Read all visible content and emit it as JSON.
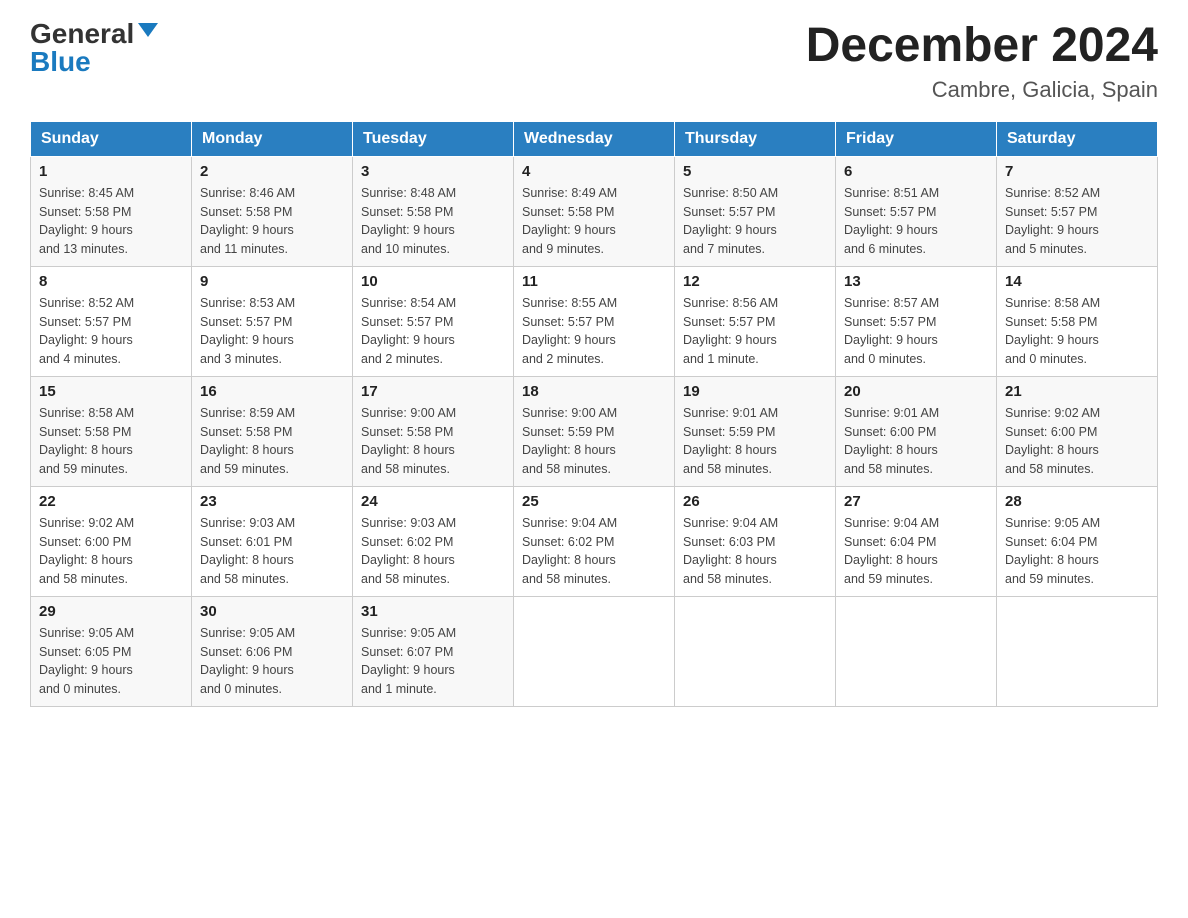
{
  "logo": {
    "general": "General",
    "blue": "Blue"
  },
  "header": {
    "month_year": "December 2024",
    "location": "Cambre, Galicia, Spain"
  },
  "days_of_week": [
    "Sunday",
    "Monday",
    "Tuesday",
    "Wednesday",
    "Thursday",
    "Friday",
    "Saturday"
  ],
  "weeks": [
    [
      {
        "day": "1",
        "sunrise": "8:45 AM",
        "sunset": "5:58 PM",
        "daylight": "9 hours and 13 minutes."
      },
      {
        "day": "2",
        "sunrise": "8:46 AM",
        "sunset": "5:58 PM",
        "daylight": "9 hours and 11 minutes."
      },
      {
        "day": "3",
        "sunrise": "8:48 AM",
        "sunset": "5:58 PM",
        "daylight": "9 hours and 10 minutes."
      },
      {
        "day": "4",
        "sunrise": "8:49 AM",
        "sunset": "5:58 PM",
        "daylight": "9 hours and 9 minutes."
      },
      {
        "day": "5",
        "sunrise": "8:50 AM",
        "sunset": "5:57 PM",
        "daylight": "9 hours and 7 minutes."
      },
      {
        "day": "6",
        "sunrise": "8:51 AM",
        "sunset": "5:57 PM",
        "daylight": "9 hours and 6 minutes."
      },
      {
        "day": "7",
        "sunrise": "8:52 AM",
        "sunset": "5:57 PM",
        "daylight": "9 hours and 5 minutes."
      }
    ],
    [
      {
        "day": "8",
        "sunrise": "8:52 AM",
        "sunset": "5:57 PM",
        "daylight": "9 hours and 4 minutes."
      },
      {
        "day": "9",
        "sunrise": "8:53 AM",
        "sunset": "5:57 PM",
        "daylight": "9 hours and 3 minutes."
      },
      {
        "day": "10",
        "sunrise": "8:54 AM",
        "sunset": "5:57 PM",
        "daylight": "9 hours and 2 minutes."
      },
      {
        "day": "11",
        "sunrise": "8:55 AM",
        "sunset": "5:57 PM",
        "daylight": "9 hours and 2 minutes."
      },
      {
        "day": "12",
        "sunrise": "8:56 AM",
        "sunset": "5:57 PM",
        "daylight": "9 hours and 1 minute."
      },
      {
        "day": "13",
        "sunrise": "8:57 AM",
        "sunset": "5:57 PM",
        "daylight": "9 hours and 0 minutes."
      },
      {
        "day": "14",
        "sunrise": "8:58 AM",
        "sunset": "5:58 PM",
        "daylight": "9 hours and 0 minutes."
      }
    ],
    [
      {
        "day": "15",
        "sunrise": "8:58 AM",
        "sunset": "5:58 PM",
        "daylight": "8 hours and 59 minutes."
      },
      {
        "day": "16",
        "sunrise": "8:59 AM",
        "sunset": "5:58 PM",
        "daylight": "8 hours and 59 minutes."
      },
      {
        "day": "17",
        "sunrise": "9:00 AM",
        "sunset": "5:58 PM",
        "daylight": "8 hours and 58 minutes."
      },
      {
        "day": "18",
        "sunrise": "9:00 AM",
        "sunset": "5:59 PM",
        "daylight": "8 hours and 58 minutes."
      },
      {
        "day": "19",
        "sunrise": "9:01 AM",
        "sunset": "5:59 PM",
        "daylight": "8 hours and 58 minutes."
      },
      {
        "day": "20",
        "sunrise": "9:01 AM",
        "sunset": "6:00 PM",
        "daylight": "8 hours and 58 minutes."
      },
      {
        "day": "21",
        "sunrise": "9:02 AM",
        "sunset": "6:00 PM",
        "daylight": "8 hours and 58 minutes."
      }
    ],
    [
      {
        "day": "22",
        "sunrise": "9:02 AM",
        "sunset": "6:00 PM",
        "daylight": "8 hours and 58 minutes."
      },
      {
        "day": "23",
        "sunrise": "9:03 AM",
        "sunset": "6:01 PM",
        "daylight": "8 hours and 58 minutes."
      },
      {
        "day": "24",
        "sunrise": "9:03 AM",
        "sunset": "6:02 PM",
        "daylight": "8 hours and 58 minutes."
      },
      {
        "day": "25",
        "sunrise": "9:04 AM",
        "sunset": "6:02 PM",
        "daylight": "8 hours and 58 minutes."
      },
      {
        "day": "26",
        "sunrise": "9:04 AM",
        "sunset": "6:03 PM",
        "daylight": "8 hours and 58 minutes."
      },
      {
        "day": "27",
        "sunrise": "9:04 AM",
        "sunset": "6:04 PM",
        "daylight": "8 hours and 59 minutes."
      },
      {
        "day": "28",
        "sunrise": "9:05 AM",
        "sunset": "6:04 PM",
        "daylight": "8 hours and 59 minutes."
      }
    ],
    [
      {
        "day": "29",
        "sunrise": "9:05 AM",
        "sunset": "6:05 PM",
        "daylight": "9 hours and 0 minutes."
      },
      {
        "day": "30",
        "sunrise": "9:05 AM",
        "sunset": "6:06 PM",
        "daylight": "9 hours and 0 minutes."
      },
      {
        "day": "31",
        "sunrise": "9:05 AM",
        "sunset": "6:07 PM",
        "daylight": "9 hours and 1 minute."
      },
      null,
      null,
      null,
      null
    ]
  ],
  "labels": {
    "sunrise": "Sunrise:",
    "sunset": "Sunset:",
    "daylight": "Daylight:"
  }
}
